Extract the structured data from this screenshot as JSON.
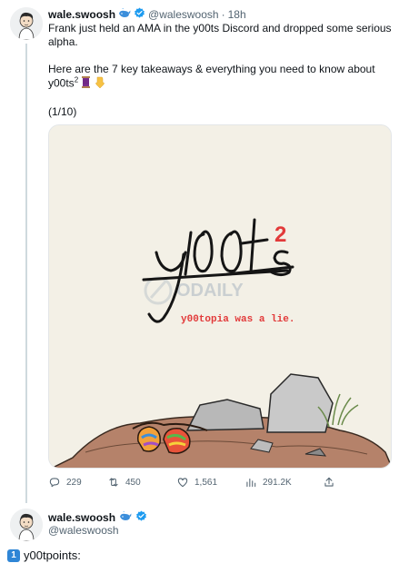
{
  "tweet1": {
    "display_name": "wale.swoosh",
    "handle": "@waleswoosh",
    "separator": "·",
    "time": "18h",
    "text_line1": "Frank just held an AMA in the y00ts Discord and dropped some serious alpha.",
    "text_line2": "Here are the 7 key takeaways & everything you need to know about y00ts",
    "text_sup": "2",
    "counter": "(1/10)",
    "media": {
      "logo_text": "y00ts",
      "logo_sup": "2",
      "tagline": "y00topia was a lie.",
      "watermark": "ODAILY"
    },
    "actions": {
      "replies": "229",
      "retweets": "450",
      "likes": "1,561",
      "views": "291.2K"
    }
  },
  "tweet2": {
    "display_name": "wale.swoosh",
    "handle": "@waleswoosh",
    "keycap": "1",
    "text": "y00tpoints:"
  },
  "colors": {
    "verified": "#1d9bf0",
    "accent_red": "#e23a3a",
    "muted": "#536471"
  },
  "icons": [
    "whale-emoji-icon",
    "verified-badge-icon",
    "thread-emoji-icon",
    "pointing-down-emoji-icon",
    "reply-icon",
    "retweet-icon",
    "like-icon",
    "views-icon",
    "share-icon"
  ]
}
